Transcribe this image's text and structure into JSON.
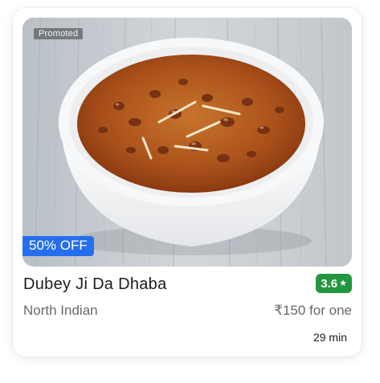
{
  "card": {
    "promoted_label": "Promoted",
    "offer_label": "50% OFF",
    "restaurant_name": "Dubey Ji Da Dhaba",
    "rating": "3.6",
    "rating_icon": "star-icon",
    "cuisine": "North Indian",
    "price": "₹150 for one",
    "delivery_time": "29 min"
  },
  "colors": {
    "offer_badge": "#256fef",
    "rating_badge": "#24963f",
    "name_text": "#1c1c1c",
    "secondary_text": "#696969"
  }
}
